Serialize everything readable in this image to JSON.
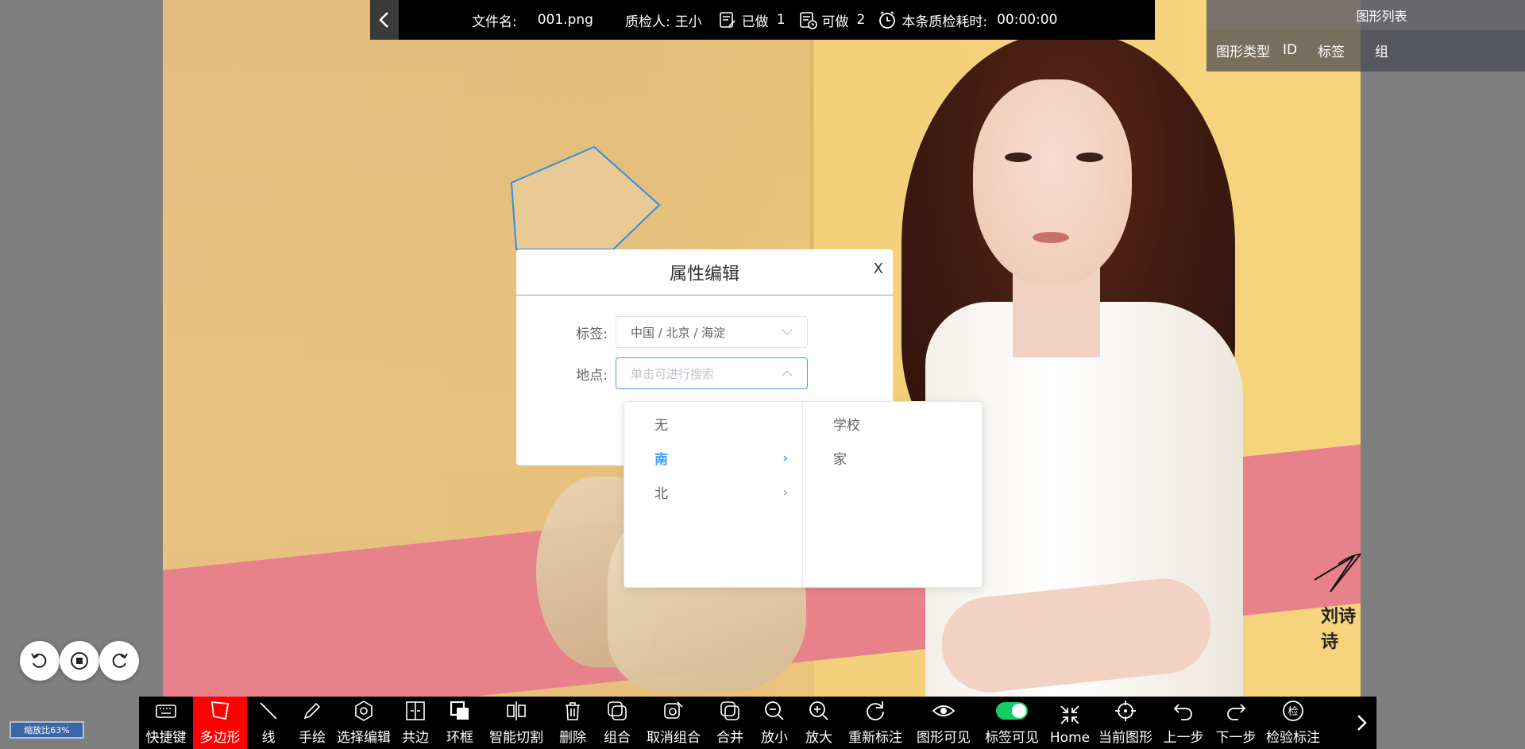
{
  "topbar": {
    "filename_label": "文件名:",
    "filename": "001.png",
    "inspector_label": "质检人:",
    "inspector": "王小",
    "done_label": "已做",
    "done_count": "1",
    "todo_label": "可做",
    "todo_count": "2",
    "time_label": "本条质检耗时:",
    "time_value": "00:00:00"
  },
  "shape_list": {
    "title": "图形列表",
    "columns": [
      "图形类型",
      "ID",
      "标签",
      "组"
    ]
  },
  "dialog": {
    "title": "属性编辑",
    "close": "X",
    "tag_label": "标签:",
    "tag_value": "中国 / 北京 / 海淀",
    "place_label": "地点:",
    "place_placeholder": "单击可进行搜索"
  },
  "dropdown": {
    "col1": [
      {
        "label": "无",
        "has_children": false,
        "active": false
      },
      {
        "label": "南",
        "has_children": true,
        "active": true
      },
      {
        "label": "北",
        "has_children": true,
        "active": false
      }
    ],
    "col2": [
      "学校",
      "家"
    ]
  },
  "image": {
    "signature_text": "刘诗诗"
  },
  "zoom": "缩放比63%",
  "toolbar": {
    "tools": [
      {
        "label": "快捷键",
        "icon": "keyboard-icon"
      },
      {
        "label": "多边形",
        "icon": "polygon-icon",
        "active": true
      },
      {
        "label": "线",
        "icon": "line-icon"
      },
      {
        "label": "手绘",
        "icon": "pencil-icon"
      },
      {
        "label": "选择编辑",
        "icon": "hexagon-edit-icon"
      },
      {
        "label": "共边",
        "icon": "shared-edge-icon"
      },
      {
        "label": "环框",
        "icon": "ring-box-icon"
      },
      {
        "label": "智能切割",
        "icon": "smart-cut-icon"
      },
      {
        "label": "删除",
        "icon": "trash-icon"
      },
      {
        "label": "组合",
        "icon": "group-icon"
      },
      {
        "label": "取消组合",
        "icon": "ungroup-icon"
      },
      {
        "label": "合并",
        "icon": "merge-icon"
      },
      {
        "label": "放小",
        "icon": "zoom-out-icon"
      },
      {
        "label": "放大",
        "icon": "zoom-in-icon"
      },
      {
        "label": "重新标注",
        "icon": "redo-circle-icon"
      },
      {
        "label": "图形可见",
        "icon": "eye-icon"
      },
      {
        "label": "标签可见",
        "icon": "toggle-icon"
      },
      {
        "label": "Home",
        "icon": "shrink-icon"
      },
      {
        "label": "当前图形",
        "icon": "crosshair-icon"
      },
      {
        "label": "上一步",
        "icon": "undo-icon"
      },
      {
        "label": "下一步",
        "icon": "redo-icon"
      },
      {
        "label": "检验标注",
        "icon": "check-badge-icon",
        "badge": "检"
      }
    ]
  }
}
